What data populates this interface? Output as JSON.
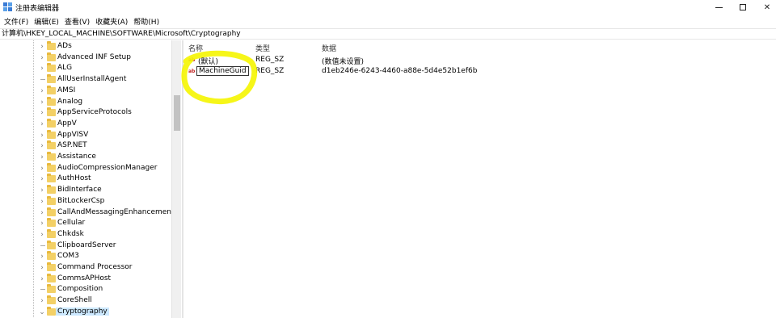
{
  "window": {
    "title": "注册表编辑器",
    "minimize": "—",
    "maximize": "□",
    "close": "✕"
  },
  "menu": [
    "文件(F)",
    "编辑(E)",
    "查看(V)",
    "收藏夹(A)",
    "帮助(H)"
  ],
  "address": "计算机\\HKEY_LOCAL_MACHINE\\SOFTWARE\\Microsoft\\Cryptography",
  "tree": {
    "items": [
      {
        "label": "ADs",
        "expandable": true
      },
      {
        "label": "Advanced INF Setup",
        "expandable": true
      },
      {
        "label": "ALG",
        "expandable": true
      },
      {
        "label": "AllUserInstallAgent",
        "expandable": false
      },
      {
        "label": "AMSI",
        "expandable": true
      },
      {
        "label": "Analog",
        "expandable": true
      },
      {
        "label": "AppServiceProtocols",
        "expandable": true
      },
      {
        "label": "AppV",
        "expandable": true
      },
      {
        "label": "AppVISV",
        "expandable": true
      },
      {
        "label": "ASP.NET",
        "expandable": true
      },
      {
        "label": "Assistance",
        "expandable": true
      },
      {
        "label": "AudioCompressionManager",
        "expandable": true
      },
      {
        "label": "AuthHost",
        "expandable": true
      },
      {
        "label": "BidInterface",
        "expandable": true
      },
      {
        "label": "BitLockerCsp",
        "expandable": true
      },
      {
        "label": "CallAndMessagingEnhancement",
        "expandable": true
      },
      {
        "label": "Cellular",
        "expandable": true
      },
      {
        "label": "Chkdsk",
        "expandable": true
      },
      {
        "label": "ClipboardServer",
        "expandable": false
      },
      {
        "label": "COM3",
        "expandable": true
      },
      {
        "label": "Command Processor",
        "expandable": true
      },
      {
        "label": "CommsAPHost",
        "expandable": true
      },
      {
        "label": "Composition",
        "expandable": false
      },
      {
        "label": "CoreShell",
        "expandable": true
      },
      {
        "label": "Cryptography",
        "expandable": true,
        "expanded": true,
        "selected": true
      }
    ]
  },
  "values": {
    "columns": {
      "name": "名称",
      "type": "类型",
      "data": "数据"
    },
    "rows": [
      {
        "name": "(默认)",
        "type": "REG_SZ",
        "data": "(数值未设置)",
        "editing": false
      },
      {
        "name": "MachineGuid",
        "type": "REG_SZ",
        "data": "d1eb246e-6243-4460-a88e-5d4e52b1ef6b",
        "editing": true
      }
    ]
  },
  "icons": {
    "app": "registry-editor-icon",
    "value": "reg-string-icon",
    "folder": "folder-icon"
  },
  "colors": {
    "highlight": "#f5f500",
    "selection": "#cce8ff",
    "folder": "#f3d066"
  }
}
